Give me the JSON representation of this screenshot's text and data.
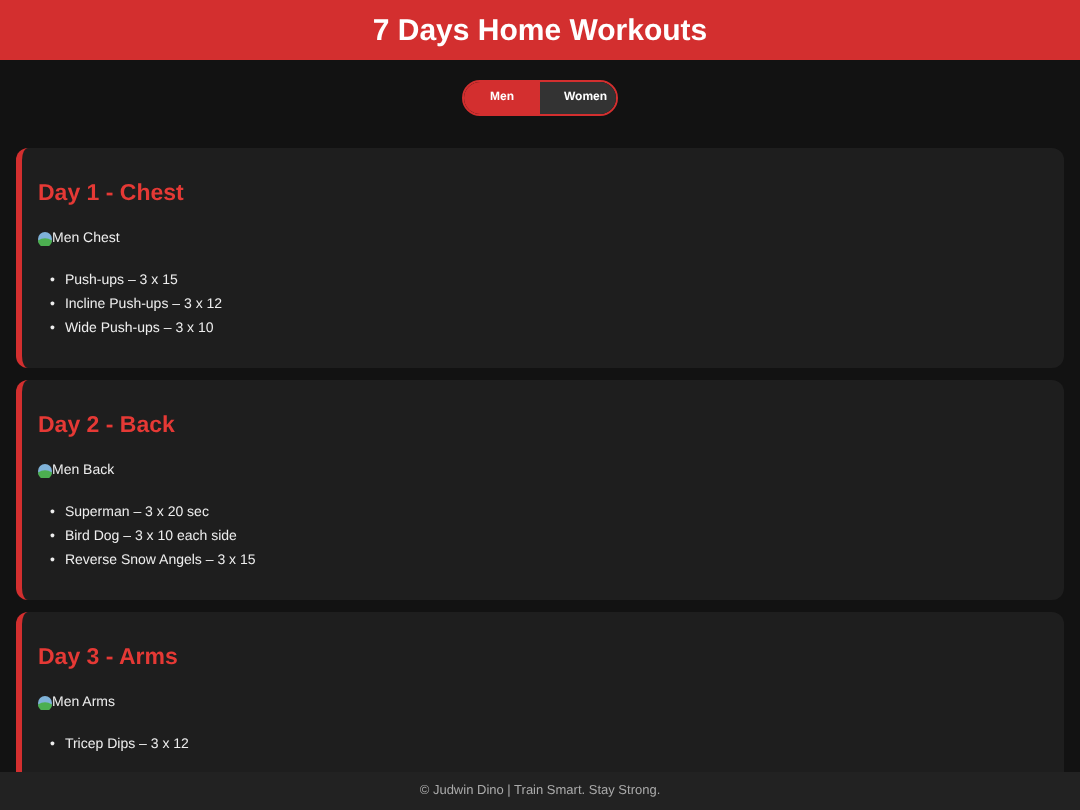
{
  "header": {
    "title": "7 Days Home Workouts"
  },
  "toggle": [
    {
      "label": "Men",
      "selected": true
    },
    {
      "label": "Women",
      "selected": false
    }
  ],
  "days": [
    {
      "title": "Day 1 - Chest",
      "image_alt": "Men Chest",
      "exercises": [
        {
          "bullet": "•",
          "text": "Push-ups – 3 x 15"
        },
        {
          "bullet": "•",
          "text": "Incline Push-ups – 3 x 12"
        },
        {
          "bullet": "•",
          "text": "Wide Push-ups – 3 x 10"
        }
      ]
    },
    {
      "title": "Day 2 - Back",
      "image_alt": "Men Back",
      "exercises": [
        {
          "bullet": "•",
          "text": "Superman – 3 x 20 sec"
        },
        {
          "bullet": "•",
          "text": "Bird Dog – 3 x 10 each side"
        },
        {
          "bullet": "•",
          "text": "Reverse Snow Angels – 3 x 15"
        }
      ]
    },
    {
      "title": "Day 3 - Arms",
      "image_alt": "Men Arms",
      "exercises": [
        {
          "bullet": "•",
          "text": "Tricep Dips – 3 x 12"
        }
      ]
    }
  ],
  "footer": "© Judwin Dino | Train Smart. Stay Strong."
}
